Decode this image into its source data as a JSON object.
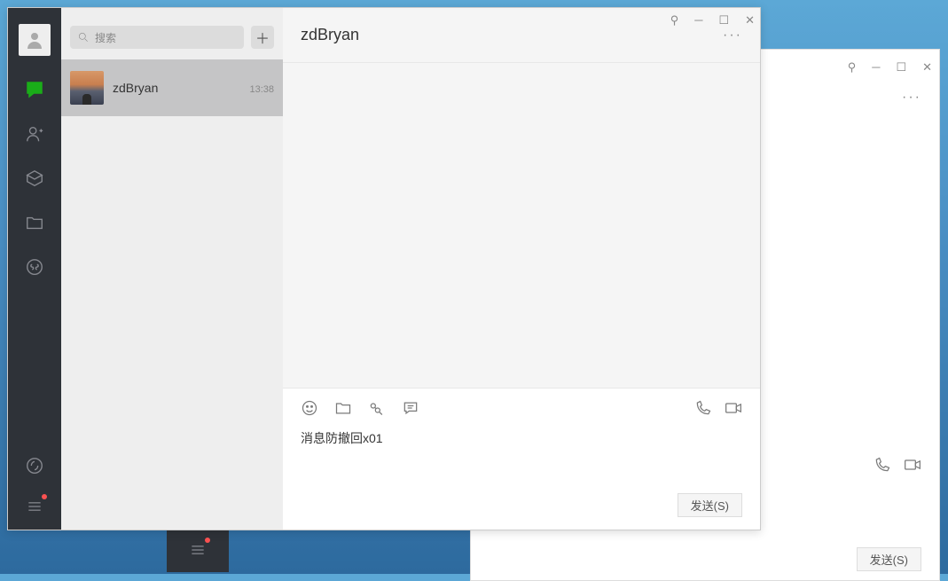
{
  "search": {
    "placeholder": "搜索"
  },
  "conversations": [
    {
      "name": "zdBryan",
      "time": "13:38"
    }
  ],
  "chat": {
    "title": "zdBryan",
    "input_value": "消息防撤回x01",
    "send_label": "发送(S)"
  },
  "bg_window": {
    "send_label": "发送(S)"
  }
}
